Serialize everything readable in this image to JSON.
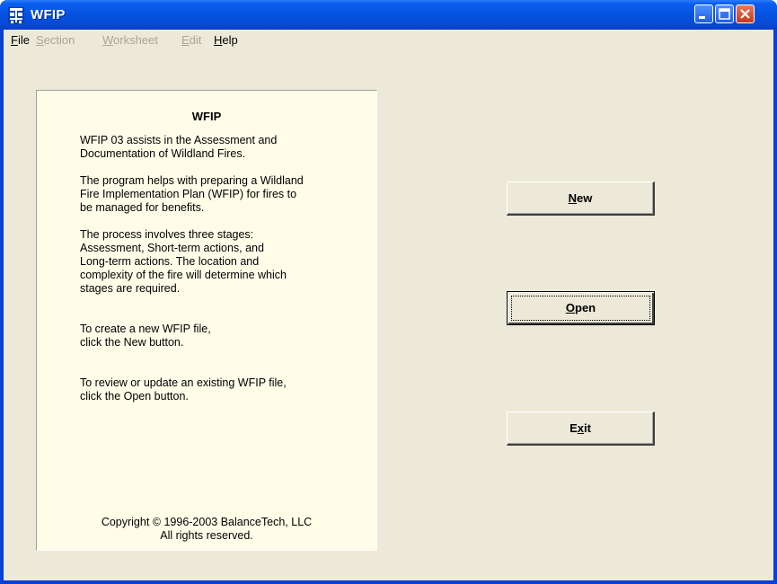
{
  "window": {
    "title": "WFIP"
  },
  "menu": [
    {
      "label": "File",
      "accel": "F",
      "rest": "ile",
      "enabled": true
    },
    {
      "label": "Section",
      "accel": "S",
      "rest": "ection",
      "enabled": false
    },
    {
      "label": "Worksheet",
      "accel": "W",
      "rest": "orksheet",
      "enabled": false
    },
    {
      "label": "Edit",
      "accel": "E",
      "rest": "dit",
      "enabled": false
    },
    {
      "label": "Help",
      "accel": "H",
      "rest": "elp",
      "enabled": true
    }
  ],
  "panel": {
    "title": "WFIP",
    "p1": "WFIP 03 assists in the Assessment and\nDocumentation of Wildland Fires.",
    "p2": "The program helps with preparing a Wildland\nFire Implementation Plan (WFIP) for fires to\nbe managed for benefits.",
    "p3": "The process involves three stages:\nAssessment, Short-term actions, and\nLong-term actions.  The location and\ncomplexity of the fire will determine which\nstages are required.",
    "p4": "To create a new WFIP file,\nclick the New button.",
    "p5": "To review or update an existing WFIP file,\nclick the Open button.",
    "copyright": "Copyright © 1996-2003 BalanceTech, LLC\nAll rights reserved."
  },
  "buttons": {
    "new": {
      "accel": "N",
      "rest": "ew"
    },
    "open": {
      "accel": "O",
      "rest": "pen"
    },
    "exit": {
      "pre": "E",
      "accel": "x",
      "rest": "it"
    }
  },
  "colors": {
    "titlebar": "#0552e0",
    "client": "#ece9d8",
    "panel": "#fffde8",
    "close_button": "#c7371a"
  },
  "icons": {
    "app": "wfip-app-icon",
    "minimize": "minimize-icon",
    "maximize": "maximize-icon",
    "close": "close-icon"
  }
}
